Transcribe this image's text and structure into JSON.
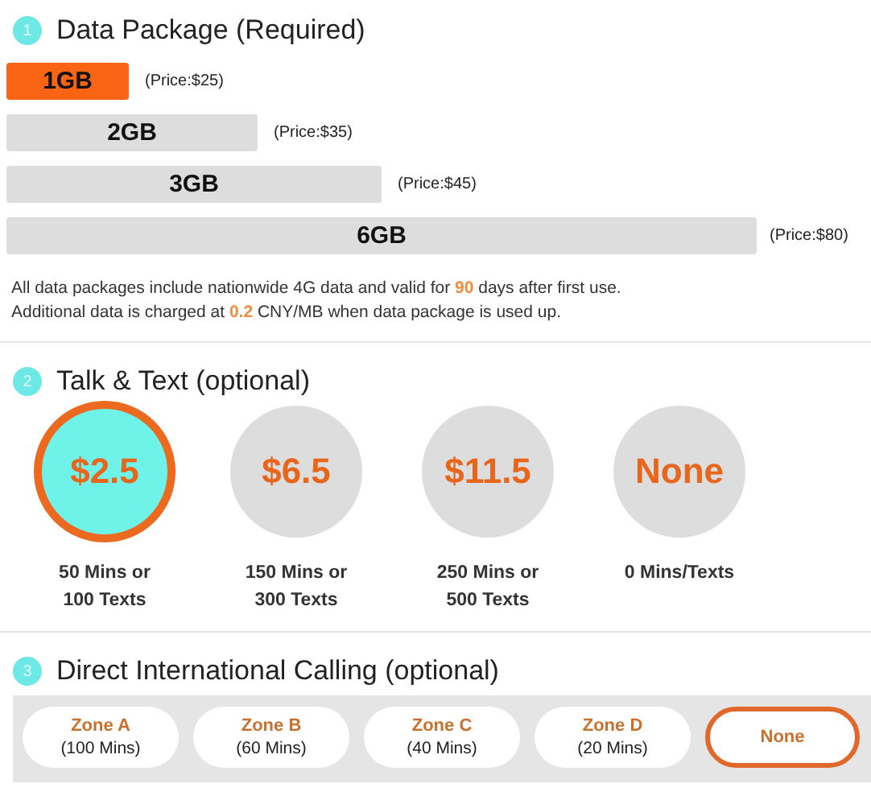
{
  "sections": [
    {
      "step": "1",
      "title": "Data Package (Required)",
      "kind": "bars",
      "packages": [
        {
          "label": "1GB",
          "price": "(Price:$25)",
          "selected": true
        },
        {
          "label": "2GB",
          "price": "(Price:$35)",
          "selected": false
        },
        {
          "label": "3GB",
          "price": "(Price:$45)",
          "selected": false
        },
        {
          "label": "6GB",
          "price": "(Price:$80)",
          "selected": false
        }
      ],
      "notes": [
        "All data packages include nationwide 4G data and valid for **90** days after first use.",
        "Additional data is charged at **0.2** CNY/MB when data package is used up."
      ]
    },
    {
      "step": "2",
      "title": "Talk & Text (optional)",
      "kind": "circles",
      "options": [
        {
          "price": "$2.5",
          "caption": "50 Mins or\n100 Texts",
          "selected": true
        },
        {
          "price": "$6.5",
          "caption": "150 Mins or\n300 Texts",
          "selected": false
        },
        {
          "price": "$11.5",
          "caption": "250 Mins or\n500 Texts",
          "selected": false
        },
        {
          "price": "None",
          "caption": "0 Mins/Texts",
          "selected": false
        }
      ]
    },
    {
      "step": "3",
      "title": "Direct International Calling (optional)",
      "kind": "pills",
      "zones": [
        {
          "name": "Zone A",
          "minutes": "(100 Mins)",
          "selected": false
        },
        {
          "name": "Zone B",
          "minutes": "(60 Mins)",
          "selected": false
        },
        {
          "name": "Zone C",
          "minutes": "(40 Mins)",
          "selected": false
        },
        {
          "name": "Zone D",
          "minutes": "(20 Mins)",
          "selected": false
        },
        {
          "name": "None",
          "selected": true
        }
      ]
    }
  ]
}
